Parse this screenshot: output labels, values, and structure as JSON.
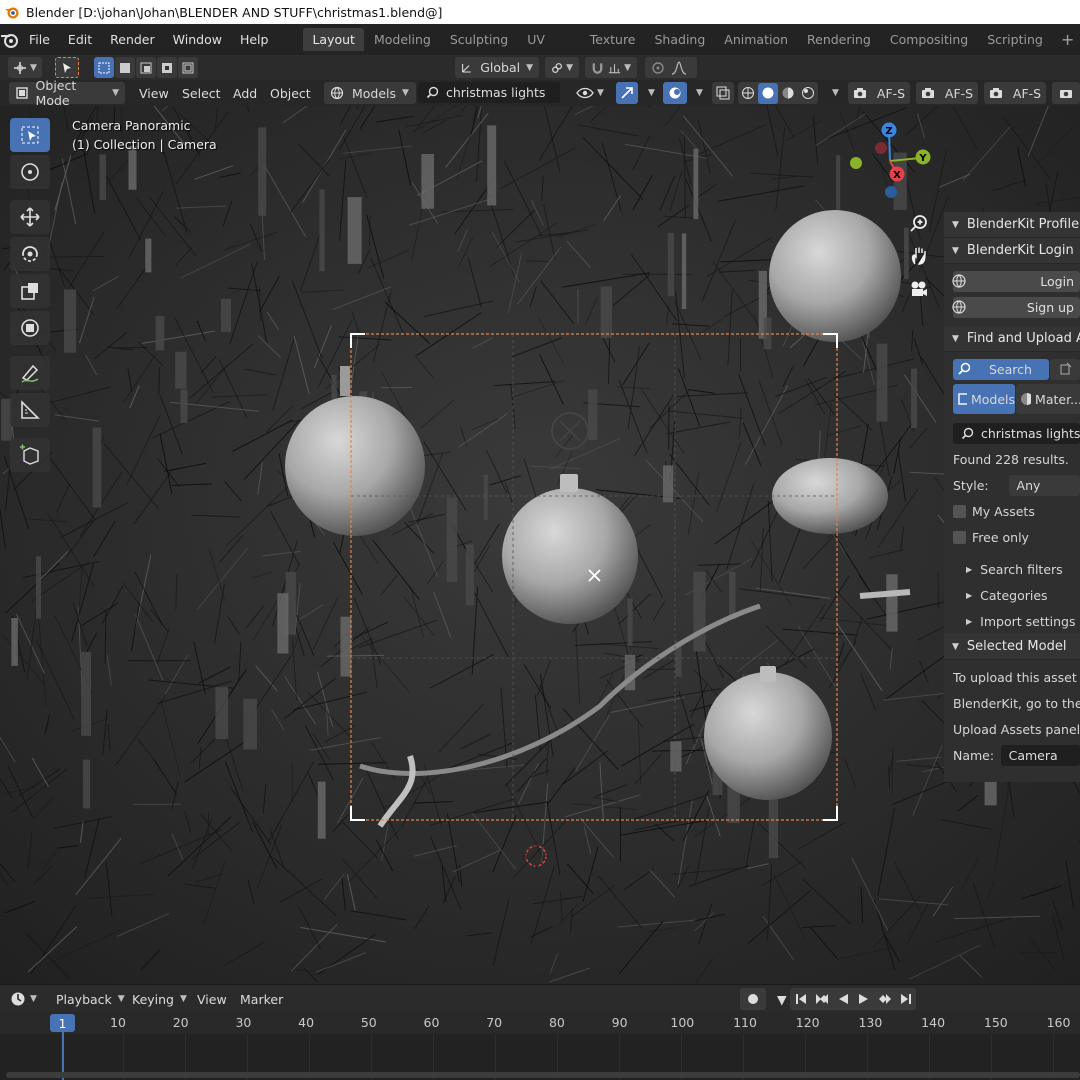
{
  "window": {
    "title": "Blender [D:\\johan\\Johan\\BLENDER AND STUFF\\christmas1.blend@]"
  },
  "menu": [
    "File",
    "Edit",
    "Render",
    "Window",
    "Help"
  ],
  "workspaces": {
    "tabs": [
      "Layout",
      "Modeling",
      "Sculpting",
      "UV Editing",
      "Texture Paint",
      "Shading",
      "Animation",
      "Rendering",
      "Compositing",
      "Scripting"
    ],
    "active": "Layout",
    "add": "+"
  },
  "tool_header": {
    "orientation": "Global"
  },
  "viewport_header": {
    "mode": "Object Mode",
    "menus": [
      "View",
      "Select",
      "Add",
      "Object"
    ],
    "asset_type": "Models",
    "search_text": "christmas lights",
    "af_buttons": [
      "AF-S",
      "AF-S",
      "AF-S"
    ]
  },
  "viewport": {
    "info_line1": "Camera Panoramic",
    "info_line2": "(1) Collection | Camera",
    "gizmo_axes": {
      "x": "X",
      "y": "Y",
      "z": "Z"
    },
    "colors": {
      "selection": "#e8834a",
      "x_axis": "#e8404a",
      "y_axis": "#8ab327",
      "z_axis": "#3d86e0"
    }
  },
  "sidebar": {
    "profile_title": "BlenderKit Profile",
    "login_title": "BlenderKit Login",
    "login_btn": "Login",
    "signup_btn": "Sign up",
    "find_title": "Find and Upload As",
    "search_tab": "Search",
    "models_tab": "Models",
    "materials_tab": "Mater...",
    "search_field": "christmas lights",
    "found": "Found 228 results.",
    "style_label": "Style:",
    "style_value": "Any",
    "my_assets": "My Assets",
    "free_only": "Free only",
    "search_filters": "Search filters",
    "categories": "Categories",
    "import_settings": "Import settings",
    "selected_title": "Selected Model",
    "upload_line1": "To upload this asset to",
    "upload_line2": "BlenderKit, go to the Fi",
    "upload_line3": "Upload Assets panel.",
    "name_label": "Name:",
    "name_value": "Camera"
  },
  "timeline": {
    "menus": [
      "Playback",
      "Keying",
      "View",
      "Marker"
    ],
    "current_frame": "1",
    "ticks": [
      "10",
      "20",
      "30",
      "40",
      "50",
      "60",
      "70",
      "80",
      "90",
      "100",
      "110",
      "120",
      "130",
      "140",
      "150",
      "160"
    ],
    "accent": "#4772b3"
  }
}
